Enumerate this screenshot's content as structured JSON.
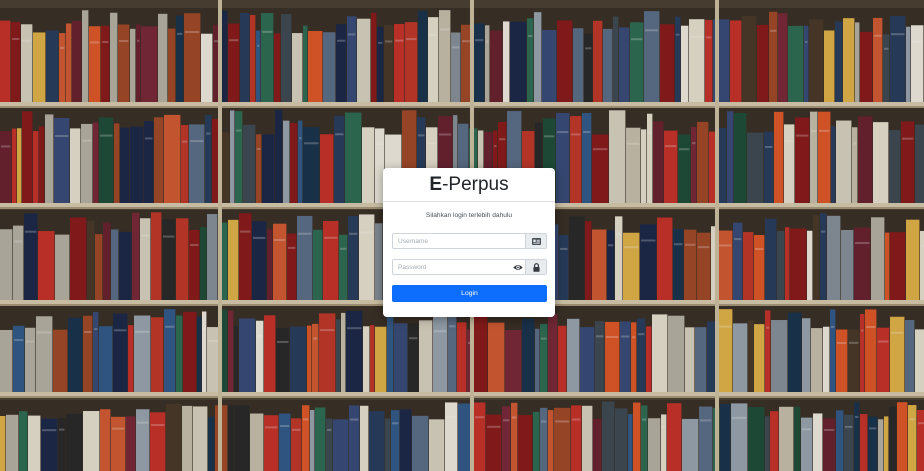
{
  "brand": {
    "bold": "E",
    "rest": "-Perpus"
  },
  "login": {
    "subtitle": "Silahkan login terlebih dahulu",
    "username_placeholder": "Username",
    "password_placeholder": "Password",
    "button_label": "Login"
  },
  "icons": {
    "username": "id-card-icon",
    "toggle_password": "eye-icon",
    "password": "lock-icon"
  },
  "colors": {
    "primary": "#0d6efd",
    "addon_bg": "#e9ecef"
  }
}
